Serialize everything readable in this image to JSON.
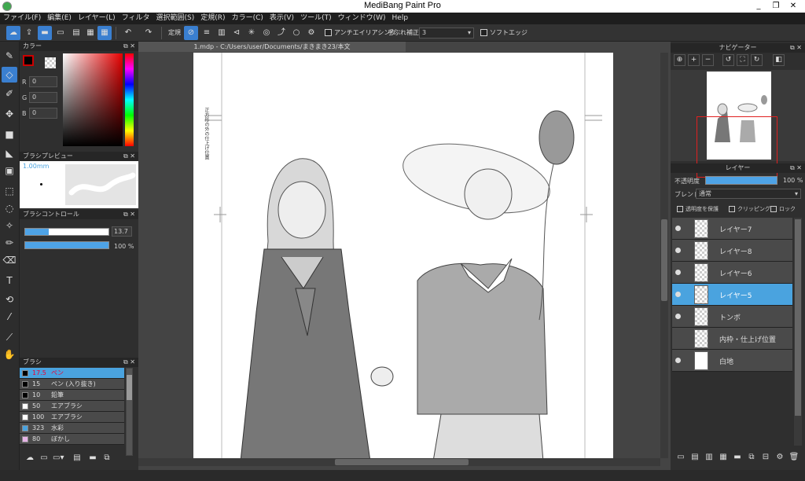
{
  "window": {
    "title": "MediBang Paint Pro",
    "minimize": "_",
    "restore": "❐",
    "close": "✕"
  },
  "menu": [
    "ファイル(F)",
    "編集(E)",
    "レイヤー(L)",
    "フィルタ",
    "選択範囲(S)",
    "定規(R)",
    "カラー(C)",
    "表示(V)",
    "ツール(T)",
    "ウィンドウ(W)",
    "Help"
  ],
  "toolbar": {
    "ruler_label": "定規",
    "antialias_label": "アンチエイリアシング",
    "stabilizer_label": "手ぶれ補正",
    "stabilizer_value": "3",
    "soft_edge_label": "ソフトエッジ"
  },
  "color_panel": {
    "title": "カラー",
    "r_label": "R",
    "r_value": "0",
    "g_label": "G",
    "g_value": "0",
    "b_label": "B",
    "b_value": "0",
    "primary_color": "#000000",
    "secondary_color": "#ffffff"
  },
  "brush_preview": {
    "title": "ブラシプレビュー",
    "size": "1.00mm"
  },
  "brush_control": {
    "title": "ブラシコントロール",
    "size_value": "13.7",
    "size_fraction": 0.28,
    "opacity_value": "100 %",
    "opacity_fraction": 1.0
  },
  "brush_list": {
    "title": "ブラシ",
    "items": [
      {
        "size": "17.5",
        "name": "ペン",
        "color": "#000000",
        "selected": true
      },
      {
        "size": "15",
        "name": "ペン (入り抜き)",
        "color": "#000000"
      },
      {
        "size": "10",
        "name": "鉛筆",
        "color": "#000000"
      },
      {
        "size": "50",
        "name": "エアブラシ",
        "color": "#ffffff"
      },
      {
        "size": "100",
        "name": "エアブラシ",
        "color": "#ffffff"
      },
      {
        "size": "323",
        "name": "水彩",
        "color": "#4aa3df"
      },
      {
        "size": "80",
        "name": "ぼかし",
        "color": "#e6b3e6"
      }
    ]
  },
  "document": {
    "tab": "1.mdp - C:/Users/user/Documents/まきまき23/本文",
    "margin_note": "正方形の外の仕上げ位置"
  },
  "navigator": {
    "title": "ナビゲーター"
  },
  "layer_panel": {
    "title": "レイヤー",
    "opacity_label": "不透明度",
    "opacity_value": "100 %",
    "opacity_fraction": 1.0,
    "blend_label": "ブレンド",
    "blend_value": "通常",
    "protect_alpha": "透明度を保護",
    "clipping": "クリッピング",
    "lock": "ロック",
    "layers": [
      {
        "name": "レイヤー7",
        "visible": true,
        "thumb": "check"
      },
      {
        "name": "レイヤー8",
        "visible": true,
        "thumb": "check"
      },
      {
        "name": "レイヤー6",
        "visible": true,
        "thumb": "check"
      },
      {
        "name": "レイヤー5",
        "visible": true,
        "thumb": "check",
        "selected": true
      },
      {
        "name": "トンボ",
        "visible": true,
        "thumb": "check"
      },
      {
        "name": "内枠・仕上げ位置",
        "visible": false,
        "thumb": "check"
      },
      {
        "name": "白地",
        "visible": true,
        "thumb": "white"
      }
    ]
  }
}
